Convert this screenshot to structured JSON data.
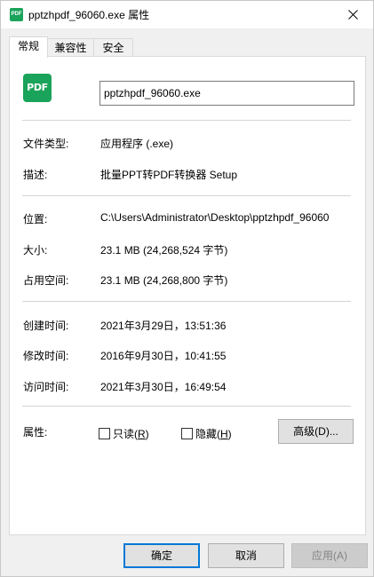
{
  "window": {
    "title": "pptzhpdf_96060.exe 属性",
    "icon": "pdf-app-icon",
    "icon_text": "PDF"
  },
  "tabs": [
    {
      "label": "常规",
      "active": true
    },
    {
      "label": "兼容性",
      "active": false
    },
    {
      "label": "安全",
      "active": false
    }
  ],
  "general": {
    "app_icon_text": "PDF",
    "file_name": "pptzhpdf_96060.exe",
    "type_label": "文件类型:",
    "type_value": "应用程序 (.exe)",
    "desc_label": "描述:",
    "desc_value": "批量PPT转PDF转换器 Setup",
    "location_label": "位置:",
    "location_value": "C:\\Users\\Administrator\\Desktop\\pptzhpdf_96060",
    "size_label": "大小:",
    "size_value": "23.1 MB (24,268,524 字节)",
    "disk_label": "占用空间:",
    "disk_value": "23.1 MB (24,268,800 字节)",
    "created_label": "创建时间:",
    "created_value": "2021年3月29日，13:51:36",
    "modified_label": "修改时间:",
    "modified_value": "2016年9月30日，10:41:55",
    "accessed_label": "访问时间:",
    "accessed_value": "2021年3月30日，16:49:54",
    "attr_label": "属性:",
    "readonly_label": "只读(",
    "readonly_key": "R",
    "readonly_end": ")",
    "hidden_label": "隐藏(",
    "hidden_key": "H",
    "hidden_end": ")",
    "advanced_button": "高级(D)..."
  },
  "buttons": {
    "ok": "确定",
    "cancel": "取消",
    "apply": "应用(A)"
  },
  "colors": {
    "accent": "#0078d7",
    "app_icon": "#1aa35a"
  }
}
